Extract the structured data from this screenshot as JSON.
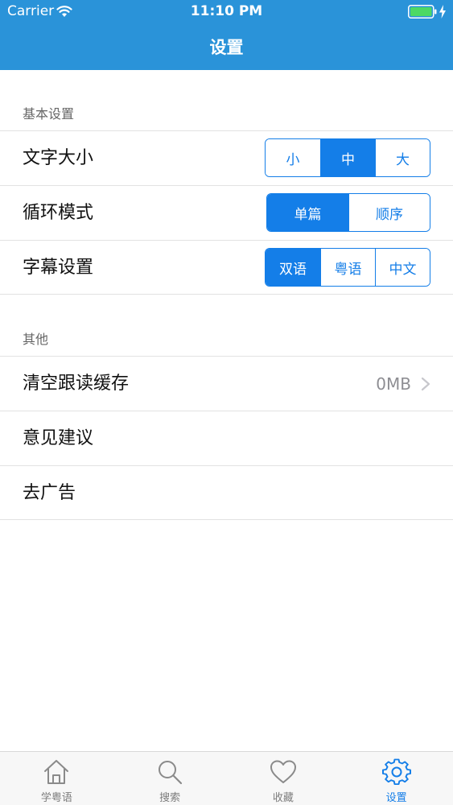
{
  "status_bar": {
    "carrier": "Carrier",
    "time": "11:10 PM",
    "icons": [
      "wifi-icon",
      "battery-icon",
      "charging-icon"
    ]
  },
  "nav": {
    "title": "设置"
  },
  "sections": {
    "basic": {
      "header": "基本设置",
      "font_size": {
        "label": "文字大小",
        "options": [
          "小",
          "中",
          "大"
        ],
        "selected": "中"
      },
      "loop_mode": {
        "label": "循环模式",
        "options": [
          "单篇",
          "顺序"
        ],
        "selected": "单篇"
      },
      "subtitle": {
        "label": "字幕设置",
        "options": [
          "双语",
          "粤语",
          "中文"
        ],
        "selected": "双语"
      }
    },
    "other": {
      "header": "其他",
      "clear_cache": {
        "label": "清空跟读缓存",
        "value": "0MB"
      },
      "feedback": {
        "label": "意见建议"
      },
      "remove_ads": {
        "label": "去广告"
      }
    }
  },
  "tabbar": {
    "items": [
      {
        "label": "学粤语",
        "icon": "home-icon",
        "active": false
      },
      {
        "label": "搜索",
        "icon": "search-icon",
        "active": false
      },
      {
        "label": "收藏",
        "icon": "heart-icon",
        "active": false
      },
      {
        "label": "设置",
        "icon": "gear-icon",
        "active": true
      }
    ]
  },
  "colors": {
    "header_bg": "#2a93d9",
    "accent": "#147ee8",
    "tab_inactive": "#7c7c7c",
    "secondary_text": "#8e8e93"
  }
}
